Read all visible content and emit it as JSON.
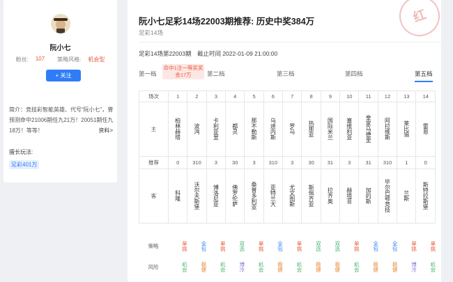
{
  "profile": {
    "name": "阮小七",
    "fans_label": "粉丝:",
    "fans_value": "107",
    "style_label": "策略风格:",
    "style_value": "机会型",
    "follow_label": "+ 关注",
    "intro": "简介：竞技彩智能英雄、代号“阮小七”，曾预测命中21006期任九21万！20051期任九18万！等等！",
    "more": "资料>",
    "tag_title": "擅长玩法:",
    "tag": "足彩401万"
  },
  "main": {
    "title": "阮小七足彩14场22003期推荐: 历史中奖384万",
    "sub": "足彩14场",
    "info_issue": "足彩14场第22003期",
    "info_deadline": "截止时间 2022-01-09 21:00:00",
    "stamp": "红",
    "badge": "命中1注一等奖奖金17万",
    "tabs": [
      "第一档",
      "第二档",
      "第三档",
      "第四档",
      "第五档"
    ],
    "active_tab": "第五档"
  },
  "table": {
    "row_labels": {
      "index": "场次",
      "home": "主",
      "rec": "推荐",
      "away": "客",
      "strategy": "策略",
      "risk": "风险"
    },
    "cols": [
      {
        "n": "1",
        "home": "柏林赫塔",
        "rec": "0",
        "away": "科隆"
      },
      {
        "n": "2",
        "home": "波鸿",
        "rec": "310",
        "away": "沃尔夫斯堡"
      },
      {
        "n": "3",
        "home": "卡利亚里",
        "rec": "3",
        "away": "博洛尼亚"
      },
      {
        "n": "4",
        "home": "都灵",
        "rec": "30",
        "away": "佛罗伦萨"
      },
      {
        "n": "5",
        "home": "那不勒斯",
        "rec": "3",
        "away": "桑普多利亚"
      },
      {
        "n": "6",
        "home": "乌迪内斯",
        "rec": "310",
        "away": "亚特兰大"
      },
      {
        "n": "7",
        "home": "罗马",
        "rec": "3",
        "away": "尤文图斯"
      },
      {
        "n": "8",
        "home": "热那亚",
        "rec": "30",
        "away": "斯佩齐亚"
      },
      {
        "n": "9",
        "home": "国际米兰",
        "rec": "31",
        "away": "拉齐奥"
      },
      {
        "n": "10",
        "home": "塞维利亚",
        "rec": "3",
        "away": "赫塔菲"
      },
      {
        "n": "11",
        "home": "皇家马德里",
        "rec": "31",
        "away": "加的斯"
      },
      {
        "n": "12",
        "home": "阿拉维斯",
        "rec": "310",
        "away": "毕尔巴鄂竞技"
      },
      {
        "n": "13",
        "home": "莱比锡",
        "rec": "1",
        "away": "兰斯"
      },
      {
        "n": "14",
        "home": "雷恩",
        "rec": "0",
        "away": "斯特拉斯堡"
      }
    ],
    "strategy": [
      "单挑",
      "全包",
      "单挑",
      "双选",
      "单挑",
      "全包",
      "单挑",
      "双选",
      "双选",
      "单挑",
      "全包",
      "全包",
      "单挑",
      "单挑"
    ],
    "risk": [
      "机会",
      "稳健",
      "机会",
      "博冷",
      "机会",
      "稳健",
      "机会",
      "稳健",
      "稳健",
      "机会",
      "稳健",
      "稳健",
      "博冷",
      "机会"
    ]
  },
  "colors": {
    "accent": "#2f7df6",
    "red": "#e85a3c",
    "green": "#49b36c"
  }
}
